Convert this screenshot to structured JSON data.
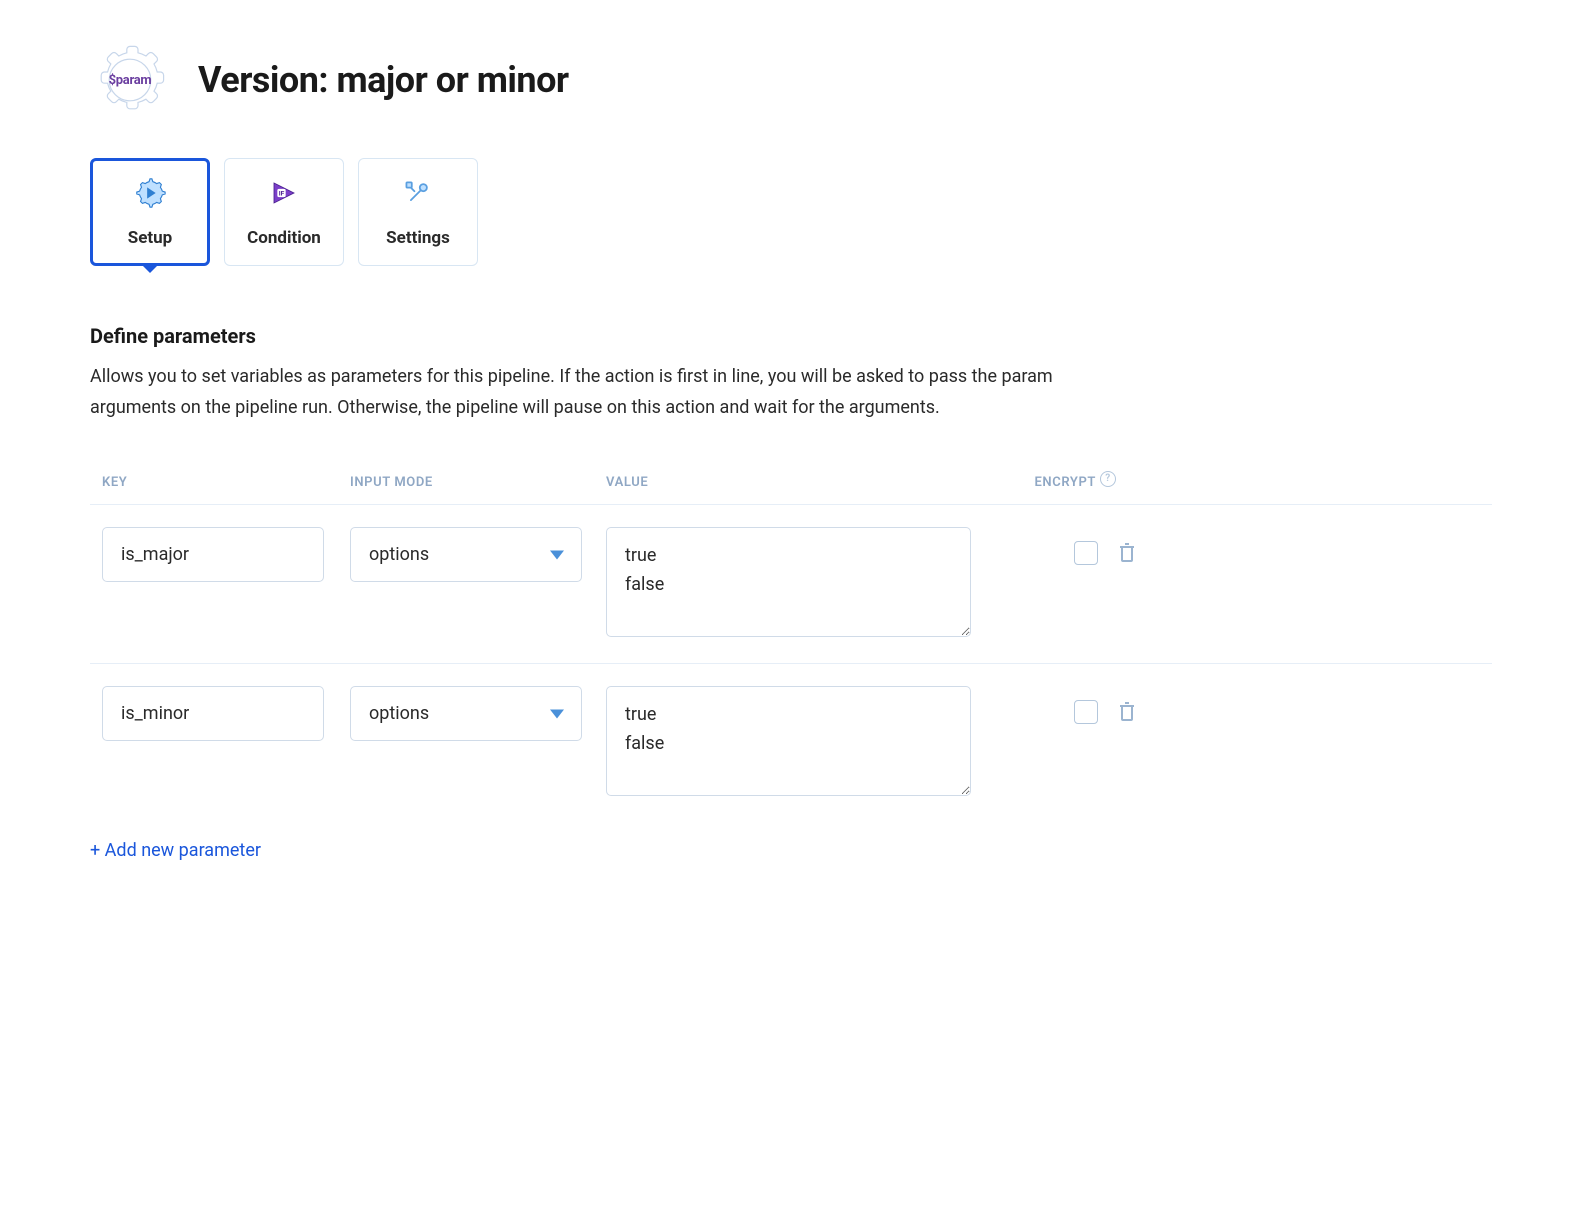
{
  "header": {
    "badge_text": "$param",
    "title": "Version: major or minor"
  },
  "tabs": [
    {
      "label": "Setup",
      "active": true
    },
    {
      "label": "Condition",
      "active": false
    },
    {
      "label": "Settings",
      "active": false
    }
  ],
  "section": {
    "title": "Define parameters",
    "description": "Allows you to set variables as parameters for this pipeline. If the action is first in line, you will be asked to pass the param arguments on the pipeline run. Otherwise, the pipeline will pause on this action and wait for the arguments."
  },
  "columns": {
    "key": "KEY",
    "input_mode": "INPUT MODE",
    "value": "VALUE",
    "encrypt": "ENCRYPT"
  },
  "rows": [
    {
      "key": "is_major",
      "mode": "options",
      "value": "true\nfalse",
      "encrypted": false
    },
    {
      "key": "is_minor",
      "mode": "options",
      "value": "true\nfalse",
      "encrypted": false
    }
  ],
  "add_link": "+ Add new parameter",
  "help_glyph": "?"
}
